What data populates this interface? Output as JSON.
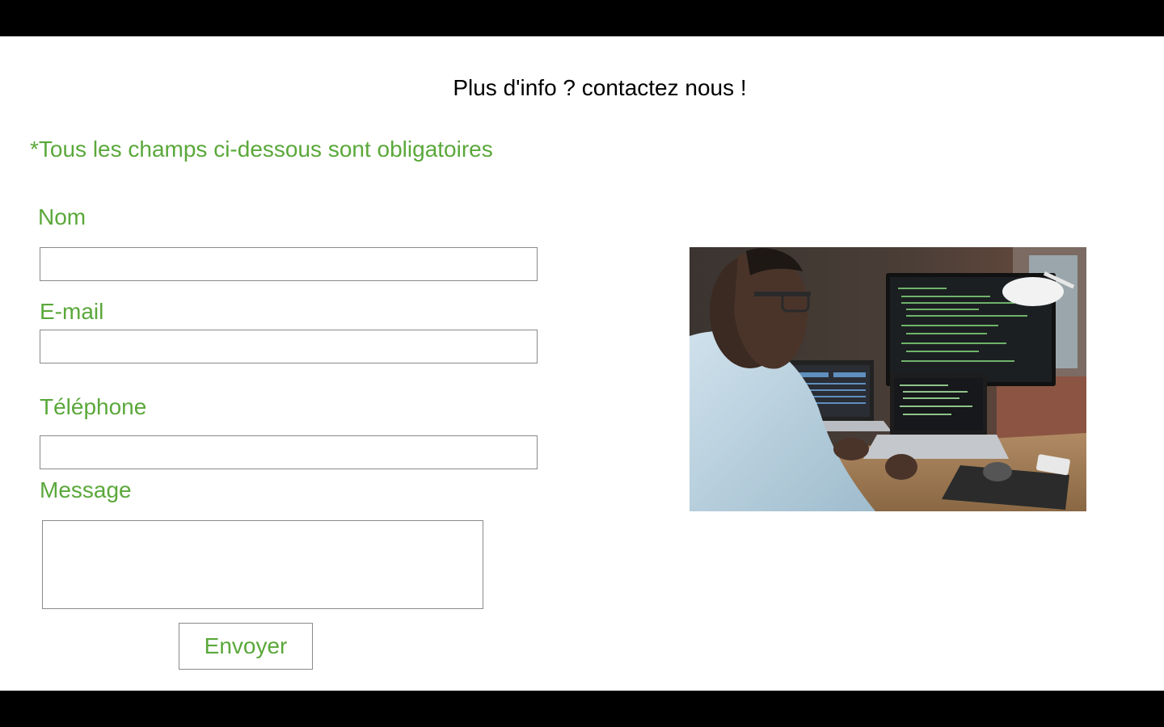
{
  "header": {
    "title": "Plus d'info ? contactez nous !"
  },
  "form": {
    "notice": "*Tous les champs ci-dessous sont obligatoires",
    "name_label": "Nom",
    "email_label": "E-mail",
    "phone_label": "Téléphone",
    "message_label": "Message",
    "name_value": "",
    "email_value": "",
    "phone_value": "",
    "message_value": "",
    "submit_label": "Envoyer"
  },
  "image": {
    "alt": "developer-at-computer-photo"
  },
  "colors": {
    "accent": "#5aa83a",
    "text": "#000000",
    "border": "#8a8a8a"
  }
}
